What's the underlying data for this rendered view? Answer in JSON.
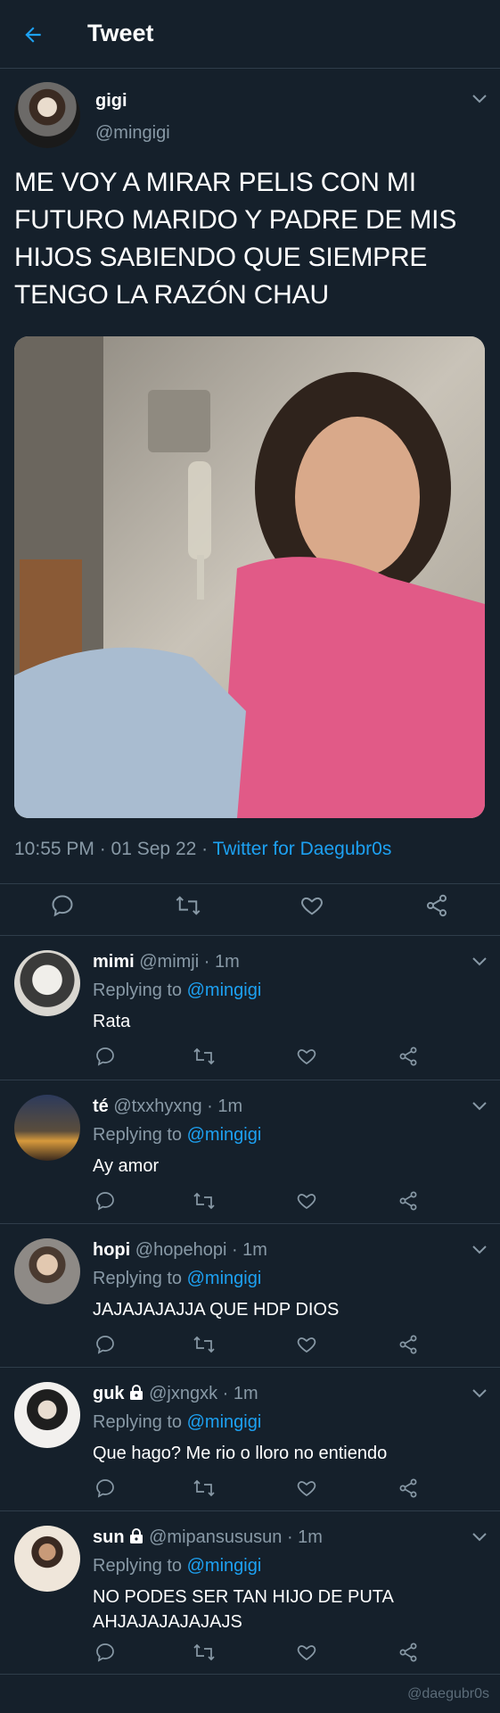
{
  "header": {
    "title": "Tweet",
    "back_icon": "arrow-left-icon",
    "accent": "#1da1f2"
  },
  "tweet": {
    "name": "gigi",
    "handle": "@mingigi",
    "text": "ME VOY A MIRAR PELIS CON MI FUTURO MARIDO Y PADRE DE MIS HIJOS SABIENDO QUE SIEMPRE TENGO LA RAZÓN CHAU",
    "time_date": "10:55 PM · 01 Sep 22 · ",
    "source": "Twitter for Daegubr0s",
    "actions": [
      "comment-icon",
      "retweet-icon",
      "heart-icon",
      "share-icon"
    ]
  },
  "replies": [
    {
      "name": "mimi",
      "handle_time": " @mimji · 1m",
      "replying_prefix": "Replying to ",
      "mention": "@mingigi",
      "text": "Rata",
      "locked": false
    },
    {
      "name": "té",
      "handle_time": " @txxhyxng · 1m",
      "replying_prefix": "Replying to ",
      "mention": "@mingigi",
      "text": "Ay amor",
      "locked": false
    },
    {
      "name": "hopi",
      "handle_time": " @hopehopi · 1m",
      "replying_prefix": "Replying to ",
      "mention": "@mingigi",
      "text": "JAJAJAJAJJA QUE HDP DIOS",
      "locked": false
    },
    {
      "name": "guk",
      "handle_time": " @jxngxk · 1m",
      "replying_prefix": "Replying to ",
      "mention": "@mingigi",
      "text": "Que hago? Me rio o lloro no entiendo",
      "locked": true
    },
    {
      "name": "sun",
      "handle_time": " @mipansususun · 1m",
      "replying_prefix": "Replying to ",
      "mention": "@mingigi",
      "text": "NO PODES SER TAN HIJO DE PUTA AHJAJAJAJAJAJS",
      "locked": true
    }
  ],
  "watermark": "@daegubr0s"
}
